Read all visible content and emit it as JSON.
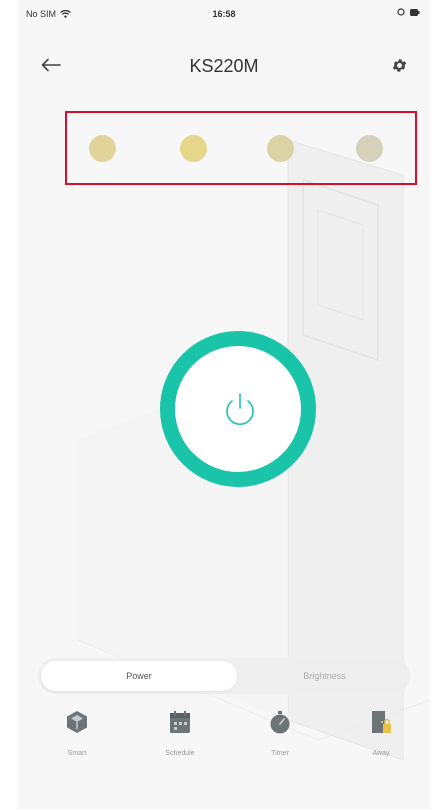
{
  "status": {
    "carrier": "No SIM",
    "time": "16:58"
  },
  "header": {
    "title": "KS220M"
  },
  "swatches": [
    {
      "name": "swatch-1",
      "color": "#e0d49a"
    },
    {
      "name": "swatch-2",
      "color": "#e6d68a"
    },
    {
      "name": "swatch-3",
      "color": "#dbd3a6"
    },
    {
      "name": "swatch-4",
      "color": "#d6d1bb"
    }
  ],
  "colors": {
    "accent": "#19c4a9",
    "highlight_border": "#d40f2d"
  },
  "power": {
    "icon": "power-icon"
  },
  "segment": {
    "tabs": [
      {
        "label": "Power",
        "active": true
      },
      {
        "label": "Brightness",
        "active": false
      }
    ]
  },
  "bottom_nav": [
    {
      "label": "Smart",
      "icon": "smart-cube-icon"
    },
    {
      "label": "Schedule",
      "icon": "calendar-icon"
    },
    {
      "label": "Timer",
      "icon": "timer-icon"
    },
    {
      "label": "Away",
      "icon": "away-door-icon"
    }
  ]
}
